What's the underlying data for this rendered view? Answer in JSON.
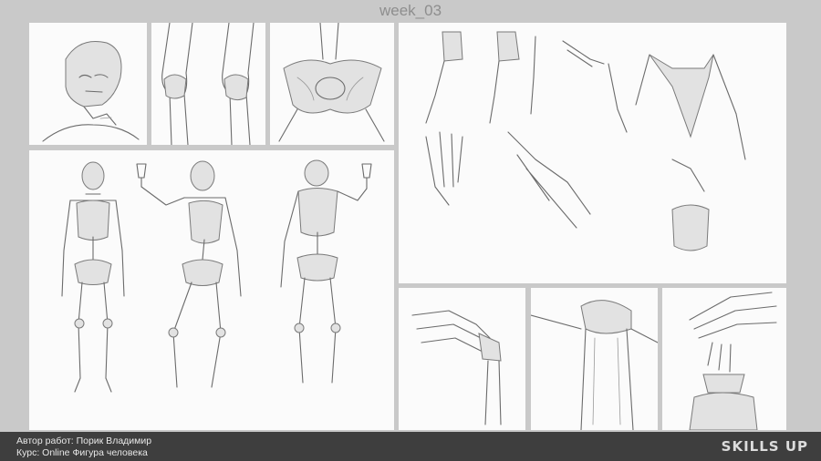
{
  "header": {
    "title": "week_03"
  },
  "footer": {
    "author_line": "Автор работ: Порик Владимир",
    "course_line": "Курс: Online Фигура человека",
    "logo_text": "SKILLS UP"
  },
  "colors": {
    "background": "#c9c9c9",
    "panel": "#fbfbfb",
    "footer": "#3e3e3e"
  }
}
